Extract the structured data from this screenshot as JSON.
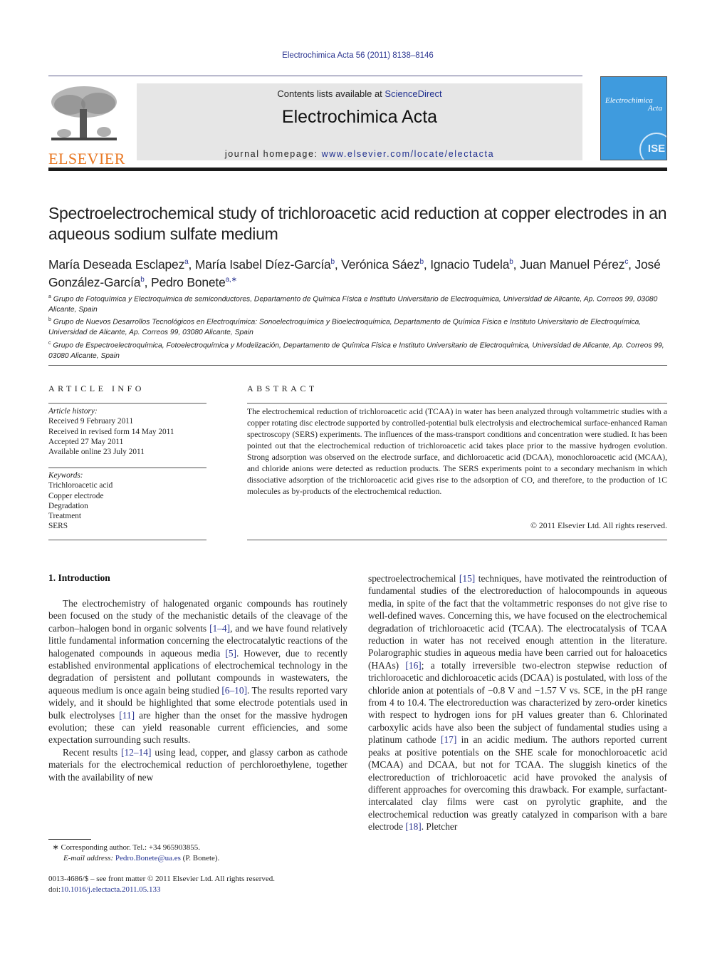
{
  "journal_ref": "Electrochimica Acta 56 (2011) 8138–8146",
  "header": {
    "publisher_logo_text": "ELSEVIER",
    "contents_prefix": "Contents lists available at ",
    "contents_link": "ScienceDirect",
    "journal_name": "Electrochimica Acta",
    "homepage_prefix": "journal homepage: ",
    "homepage_link": "www.elsevier.com/locate/electacta",
    "cover_title_line1": "Electrochimica",
    "cover_title_line2": "Acta",
    "cover_badge": "ISE"
  },
  "article": {
    "title": "Spectroelectrochemical study of trichloroacetic acid reduction at copper electrodes in an aqueous sodium sulfate medium",
    "authors": [
      {
        "name": "María Deseada Esclapez",
        "sup": "a"
      },
      {
        "name": "María Isabel Díez-García",
        "sup": "b"
      },
      {
        "name": "Verónica Sáez",
        "sup": "b"
      },
      {
        "name": "Ignacio Tudela",
        "sup": "b"
      },
      {
        "name": "Juan Manuel Pérez",
        "sup": "c"
      },
      {
        "name": "José González-García",
        "sup": "b"
      },
      {
        "name": "Pedro Bonete",
        "sup": "a,∗"
      }
    ],
    "affiliations": [
      {
        "mark": "a",
        "text": "Grupo de Fotoquímica y Electroquímica de semiconductores, Departamento de Química Física e Instituto Universitario de Electroquímica, Universidad de Alicante, Ap. Correos 99, 03080 Alicante, Spain"
      },
      {
        "mark": "b",
        "text": "Grupo de Nuevos Desarrollos Tecnológicos en Electroquímica: Sonoelectroquímica y Bioelectroquímica, Departamento de Química Física e Instituto Universitario de Electroquímica, Universidad de Alicante, Ap. Correos 99, 03080 Alicante, Spain"
      },
      {
        "mark": "c",
        "text": "Grupo de Espectroelectroquímica, Fotoelectroquímica y Modelización, Departamento de Química Física e Instituto Universitario de Electroquímica, Universidad de Alicante, Ap. Correos 99, 03080 Alicante, Spain"
      }
    ]
  },
  "article_info": {
    "label": "ARTICLE INFO",
    "history_heading": "Article history:",
    "history": [
      "Received 9 February 2011",
      "Received in revised form 14 May 2011",
      "Accepted 27 May 2011",
      "Available online 23 July 2011"
    ],
    "keywords_heading": "Keywords:",
    "keywords": [
      "Trichloroacetic acid",
      "Copper electrode",
      "Degradation",
      "Treatment",
      "SERS"
    ]
  },
  "abstract": {
    "label": "ABSTRACT",
    "text": "The electrochemical reduction of trichloroacetic acid (TCAA) in water has been analyzed through voltammetric studies with a copper rotating disc electrode supported by controlled-potential bulk electrolysis and electrochemical surface-enhanced Raman spectroscopy (SERS) experiments. The influences of the mass-transport conditions and concentration were studied. It has been pointed out that the electrochemical reduction of trichloroacetic acid takes place prior to the massive hydrogen evolution. Strong adsorption was observed on the electrode surface, and dichloroacetic acid (DCAA), monochloroacetic acid (MCAA), and chloride anions were detected as reduction products. The SERS experiments point to a secondary mechanism in which dissociative adsorption of the trichloroacetic acid gives rise to the adsorption of CO, and therefore, to the production of 1C molecules as by-products of the electrochemical reduction.",
    "copyright": "© 2011 Elsevier Ltd. All rights reserved."
  },
  "body": {
    "section_heading": "1.  Introduction",
    "left_paragraphs": [
      [
        {
          "t": "The electrochemistry of halogenated organic compounds has routinely been focused on the study of the mechanistic details of the cleavage of the carbon–halogen bond in organic solvents "
        },
        {
          "c": "[1–4]"
        },
        {
          "t": ", and we have found relatively little fundamental information concerning the electrocatalytic reactions of the halogenated compounds in aqueous media "
        },
        {
          "c": "[5]"
        },
        {
          "t": ". However, due to recently established environmental applications of electrochemical technology in the degradation of persistent and pollutant compounds in wastewaters, the aqueous medium is once again being studied "
        },
        {
          "c": "[6–10]"
        },
        {
          "t": ". The results reported vary widely, and it should be highlighted that some electrode potentials used in bulk electrolyses "
        },
        {
          "c": "[11]"
        },
        {
          "t": " are higher than the onset for the massive hydrogen evolution; these can yield reasonable current efficiencies, and some expectation surrounding such results."
        }
      ],
      [
        {
          "t": "Recent results "
        },
        {
          "c": "[12–14]"
        },
        {
          "t": " using lead, copper, and glassy carbon as cathode materials for the electrochemical reduction of perchloroethylene, together with the availability of new"
        }
      ]
    ],
    "right_paragraphs": [
      [
        {
          "t": "spectroelectrochemical "
        },
        {
          "c": "[15]"
        },
        {
          "t": " techniques, have motivated the reintroduction of fundamental studies of the electroreduction of halocompounds in aqueous media, in spite of the fact that the voltammetric responses do not give rise to well-defined waves. Concerning this, we have focused on the electrochemical degradation of trichloroacetic acid (TCAA). The electrocatalysis of TCAA reduction in water has not received enough attention in the literature. Polarographic studies in aqueous media have been carried out for haloacetics (HAAs) "
        },
        {
          "c": "[16]"
        },
        {
          "t": "; a totally irreversible two-electron stepwise reduction of trichloroacetic and dichloroacetic acids (DCAA) is postulated, with loss of the chloride anion at potentials of −0.8 V and −1.57 V vs. SCE, in the pH range from 4 to 10.4. The electroreduction was characterized by zero-order kinetics with respect to hydrogen ions for pH values greater than 6. Chlorinated carboxylic acids have also been the subject of fundamental studies using a platinum cathode "
        },
        {
          "c": "[17]"
        },
        {
          "t": " in an acidic medium. The authors reported current peaks at positive potentials on the SHE scale for monochloroacetic acid (MCAA) and DCAA, but not for TCAA. The sluggish kinetics of the electroreduction of trichloroacetic acid have provoked the analysis of different approaches for overcoming this drawback. For example, surfactant-intercalated clay films were cast on pyrolytic graphite, and the electrochemical reduction was greatly catalyzed in comparison with a bare electrode "
        },
        {
          "c": "[18]"
        },
        {
          "t": ". Pletcher"
        }
      ]
    ]
  },
  "footnote": {
    "star": "∗",
    "corresponding": " Corresponding author. Tel.: +34 965903855.",
    "email_label": "E-mail address: ",
    "email": "Pedro.Bonete@ua.es",
    "email_suffix": " (P. Bonete)."
  },
  "front_matter": {
    "issn_line": "0013-4686/$ – see front matter © 2011 Elsevier Ltd. All rights reserved.",
    "doi_prefix": "doi:",
    "doi": "10.1016/j.electacta.2011.05.133"
  },
  "colors": {
    "link": "#2b3590",
    "elsevier_orange": "#e87722",
    "cover_blue": "#3f9bde",
    "header_grey": "#e6e6e6"
  }
}
